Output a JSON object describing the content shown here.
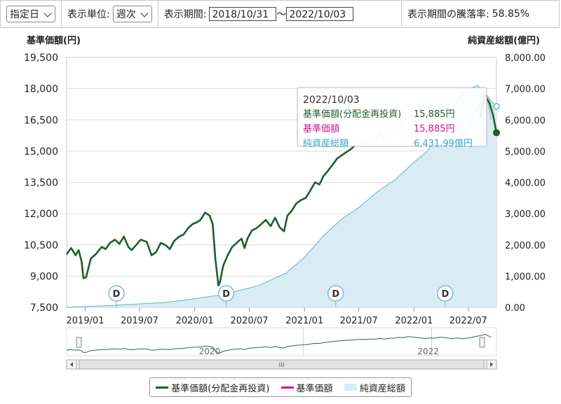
{
  "toolbar": {
    "date_mode": "指定日",
    "unit_label": "表示単位:",
    "unit_value": "週次",
    "period_label": "表示期間:",
    "start_date": "2018/10/31",
    "separator": "〜",
    "end_date": "2022/10/03",
    "change_label": "表示期間の騰落率:",
    "change_value": "58.85%"
  },
  "colors": {
    "nav_reinvested": "#1e5e2e",
    "nav": "#d0168e",
    "aum_fill": "#d8ecf1",
    "aum_line": "#5bb4cf",
    "tooltip_grey": "#bbbbbb"
  },
  "tooltip": {
    "date": "2022/10/03",
    "rows": [
      {
        "label": "基準価額(分配金再投資)",
        "value": "15,885円"
      },
      {
        "label": "基準価額",
        "value": "15,885円"
      },
      {
        "label": "純資産総額",
        "value": "6,431.99億円"
      }
    ]
  },
  "legend": {
    "items": [
      "基準価額(分配金再投資)",
      "基準価額",
      "純資産総額"
    ]
  },
  "chart_data": {
    "type": "line",
    "left_axis_title": "基準価額(円)",
    "right_axis_title": "純資産総額(億円)",
    "ylim_left": [
      7500,
      19500
    ],
    "ylim_right": [
      0,
      8000
    ],
    "left_ticks": [
      "19,500",
      "18,000",
      "16,500",
      "15,000",
      "13,500",
      "12,000",
      "10,500",
      "9,000",
      "7,500"
    ],
    "right_ticks": [
      "8,000.00",
      "7,000.00",
      "6,000.00",
      "5,000.00",
      "4,000.00",
      "3,000.00",
      "2,000.00",
      "1,000.00",
      "0.00"
    ],
    "x_ticks": [
      "2019/01",
      "2019/07",
      "2020/01",
      "2020/07",
      "2021/01",
      "2021/07",
      "2022/01",
      "2022/07"
    ],
    "x_range": [
      "2018-10-31",
      "2022-10-03"
    ],
    "navigator_labels": [
      "2020",
      "2022"
    ],
    "navigator_scroll_label": "III",
    "distribution_marker_label": "D",
    "distribution_dates": [
      "2019-04-15",
      "2020-04-15",
      "2021-04-15",
      "2022-04-15"
    ],
    "series": [
      {
        "name": "基準価額(分配金再投資)",
        "x": [
          "2018-10-31",
          "2018-11-15",
          "2018-11-30",
          "2018-12-10",
          "2018-12-20",
          "2018-12-26",
          "2019-01-04",
          "2019-01-20",
          "2019-02-05",
          "2019-02-25",
          "2019-03-10",
          "2019-03-25",
          "2019-04-10",
          "2019-04-25",
          "2019-05-10",
          "2019-05-25",
          "2019-06-05",
          "2019-06-20",
          "2019-07-05",
          "2019-07-25",
          "2019-08-10",
          "2019-08-25",
          "2019-09-10",
          "2019-09-25",
          "2019-10-10",
          "2019-10-25",
          "2019-11-10",
          "2019-11-25",
          "2019-12-10",
          "2019-12-25",
          "2020-01-10",
          "2020-01-20",
          "2020-02-05",
          "2020-02-20",
          "2020-03-01",
          "2020-03-10",
          "2020-03-20",
          "2020-03-25",
          "2020-04-05",
          "2020-04-20",
          "2020-05-05",
          "2020-05-20",
          "2020-06-05",
          "2020-06-15",
          "2020-06-25",
          "2020-07-10",
          "2020-07-25",
          "2020-08-10",
          "2020-08-25",
          "2020-09-10",
          "2020-09-25",
          "2020-10-10",
          "2020-10-25",
          "2020-11-05",
          "2020-11-20",
          "2020-12-05",
          "2020-12-20",
          "2021-01-05",
          "2021-01-20",
          "2021-02-05",
          "2021-02-20",
          "2021-03-05",
          "2021-03-20",
          "2021-04-05",
          "2021-04-20",
          "2021-05-05",
          "2021-05-20",
          "2021-06-05",
          "2021-06-20"
        ],
        "values": [
          10050,
          10350,
          10000,
          10250,
          9700,
          8900,
          8950,
          9850,
          10050,
          10400,
          10300,
          10600,
          10750,
          10550,
          10900,
          10400,
          10250,
          10500,
          10750,
          10650,
          10000,
          10150,
          10600,
          10500,
          10300,
          10700,
          10900,
          11000,
          11300,
          11500,
          11600,
          11700,
          12050,
          11900,
          11500,
          9800,
          8550,
          8700,
          9500,
          10000,
          10400,
          10600,
          10800,
          10350,
          10800,
          11200,
          11300,
          11500,
          11700,
          11400,
          11800,
          11350,
          11150,
          11900,
          12150,
          12500,
          12650,
          12750,
          13100,
          13500,
          13400,
          13800,
          14050,
          14350,
          14650,
          14800,
          14950,
          15100,
          15300
        ]
      },
      {
        "name": "基準価額",
        "x": [
          "2021-06-20",
          "2021-07-10",
          "2021-07-25",
          "2021-08-10",
          "2021-08-25",
          "2021-09-10",
          "2021-09-25",
          "2021-10-10",
          "2021-10-25",
          "2021-11-10",
          "2021-11-25",
          "2021-12-10",
          "2021-12-25",
          "2022-01-10",
          "2022-01-25",
          "2022-02-10",
          "2022-02-25",
          "2022-03-10",
          "2022-03-25",
          "2022-04-10",
          "2022-04-25",
          "2022-05-10",
          "2022-05-25",
          "2022-06-10",
          "2022-06-25",
          "2022-07-10",
          "2022-07-25",
          "2022-08-10",
          "2022-08-20",
          "2022-08-25",
          "2022-09-01",
          "2022-09-10",
          "2022-09-15"
        ],
        "values": [
          15300,
          15500,
          15350,
          15700,
          15500,
          15900,
          15600,
          16000,
          16100,
          16500,
          16300,
          16800,
          16700,
          16400,
          16100,
          15900,
          16200,
          16000,
          16500,
          16400,
          16100,
          15800,
          16200,
          15700,
          16000,
          16400,
          16900,
          17300,
          17700,
          18000,
          17600,
          16900,
          16500
        ]
      },
      {
        "name": "基準価額(分配金再投資) 2",
        "x": [
          "2022-08-10",
          "2022-08-25",
          "2022-09-10",
          "2022-09-22",
          "2022-10-03"
        ],
        "values": [
          16600,
          17700,
          17300,
          16700,
          15885
        ]
      },
      {
        "name": "純資産総額",
        "x": [
          "2018-10-31",
          "2019-04-01",
          "2019-10-01",
          "2020-04-01",
          "2020-08-01",
          "2020-11-01",
          "2021-01-01",
          "2021-03-01",
          "2021-05-01",
          "2021-07-01",
          "2021-09-01",
          "2021-11-01",
          "2022-01-01",
          "2022-02-15",
          "2022-04-01",
          "2022-05-01",
          "2022-06-01",
          "2022-07-01",
          "2022-08-01",
          "2022-08-25",
          "2022-09-15",
          "2022-10-03"
        ],
        "values": [
          2,
          60,
          160,
          400,
          700,
          1100,
          1600,
          2250,
          2800,
          3200,
          3700,
          4100,
          4650,
          5000,
          5700,
          6150,
          6700,
          7000,
          7100,
          6900,
          6600,
          6432
        ]
      }
    ]
  }
}
